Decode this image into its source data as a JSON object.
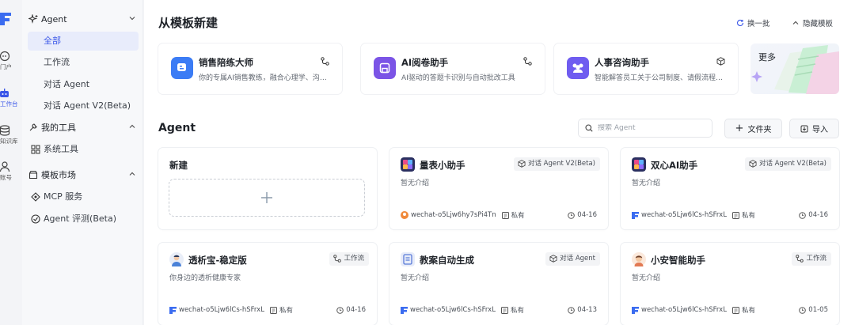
{
  "rail": {
    "items": [
      {
        "label": "门户"
      },
      {
        "label": "工作台"
      },
      {
        "label": "知识库"
      },
      {
        "label": "账号"
      }
    ]
  },
  "sidebar": {
    "agent_group": "Agent",
    "agent_items": [
      "全部",
      "工作流",
      "对话 Agent",
      "对话 Agent V2(Beta)"
    ],
    "tools_group": "我的工具",
    "system_tools": "系统工具",
    "market_group": "模板市场",
    "mcp": "MCP 服务",
    "eval": "Agent 评测(Beta)"
  },
  "templates": {
    "title": "从模板新建",
    "refresh": "换一批",
    "hide": "隐藏模板",
    "more": "更多",
    "items": [
      {
        "name": "销售陪练大师",
        "desc": "你的专属AI销售教练，融合心理学、沟通技巧与实战话术",
        "icon_color": "#3b7cf5"
      },
      {
        "name": "AI阅卷助手",
        "desc": "AI驱动的答题卡识别与自动批改工具",
        "icon_color": "#7b54e6"
      },
      {
        "name": "人事咨询助手",
        "desc": "智能解答员工关于公司制度、请假流程等问题",
        "icon_color": "#6f5cf0"
      }
    ]
  },
  "agents": {
    "title": "Agent",
    "search_placeholder": "搜索 Agent",
    "folder_btn": "文件夹",
    "import_btn": "导入",
    "new_label": "新建",
    "cards": [
      {
        "name": "量表小助手",
        "tag": "对话 Agent V2(Beta)",
        "desc": "暂无介绍",
        "owner": "wechat-o5Ljw6hy7sPi4Tn",
        "privacy": "私有",
        "date": "04-16"
      },
      {
        "name": "双心AI助手",
        "tag": "对话 Agent V2(Beta)",
        "desc": "暂无介绍",
        "owner": "wechat-o5Ljw6lCs-hSFrxL",
        "privacy": "私有",
        "date": "04-16"
      },
      {
        "name": "透析宝-稳定版",
        "tag": "工作流",
        "desc": "你身边的透析健康专家",
        "owner": "wechat-o5Ljw6lCs-hSFrxL",
        "privacy": "私有",
        "date": "04-16"
      },
      {
        "name": "教案自动生成",
        "tag": "对话 Agent",
        "desc": "暂无介绍",
        "owner": "wechat-o5Ljw6lCs-hSFrxL",
        "privacy": "私有",
        "date": "04-13"
      },
      {
        "name": "小安智能助手",
        "tag": "工作流",
        "desc": "暂无介绍",
        "owner": "wechat-o5Ljw6lCs-hSFrxL",
        "privacy": "私有",
        "date": "01-05"
      }
    ]
  },
  "colors": {
    "accent": "#3b57e8",
    "active_bg": "#e8ecfb"
  }
}
